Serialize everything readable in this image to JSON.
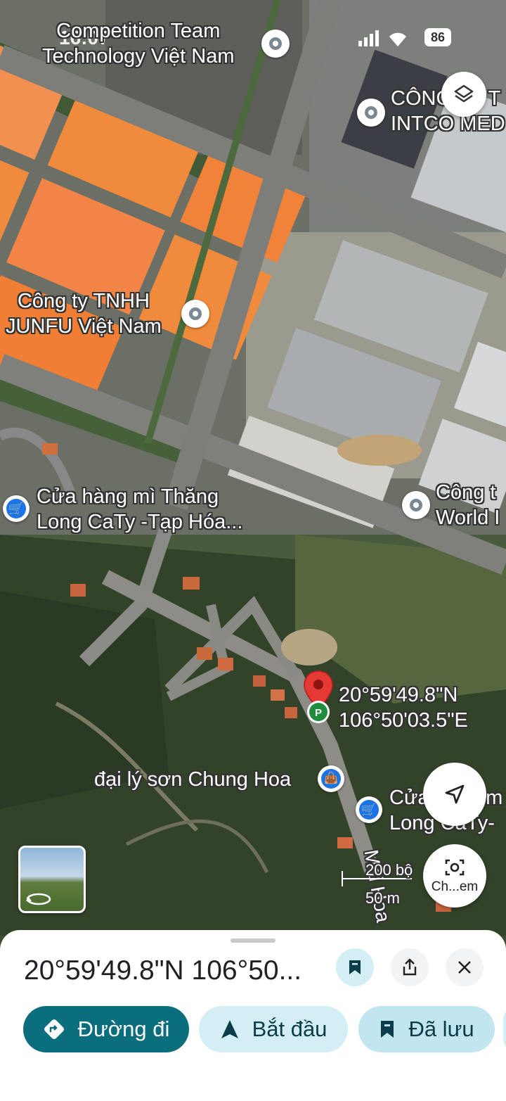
{
  "status_bar": {
    "time": "16:07",
    "battery": "86"
  },
  "map": {
    "pois": [
      {
        "name_line1": "Competition Team",
        "name_line2": "Technology Việt Nam"
      },
      {
        "name_line1": "CÔNG TY T",
        "name_line2": "INTCO MED"
      },
      {
        "name_line1": "Công ty TNHH",
        "name_line2": "JUNFU Việt Nam"
      },
      {
        "name_line1": "Cửa hàng mì Thăng",
        "name_line2": "Long CaTy -Tạp Hóa..."
      },
      {
        "name_line1": "Công t",
        "name_line2": "World I"
      },
      {
        "name_line1": "đại lý sơn Chung Hoa",
        "name_line2": ""
      },
      {
        "name_line1": "Cửa hàng m",
        "name_line2": "Long CaTy-"
      }
    ],
    "dropped_pin": {
      "lat": "20°59'49.8\"N",
      "lng": "106°50'03.5\"E"
    },
    "road_label": "Mai Hoa",
    "scale": {
      "feet": "200 bộ",
      "meters": "50 m"
    },
    "lens_label": "Ch...em",
    "icons": {
      "layers": "layers-icon",
      "locate": "navigation-arrow-icon",
      "lens": "lens-camera-icon",
      "streetview": "street-view-rotate-icon"
    }
  },
  "sheet": {
    "title": "20°59'49.8\"N 106°50...",
    "actions": {
      "directions": "Đường đi",
      "start": "Bắt đầu",
      "saved": "Đã lưu"
    },
    "colors": {
      "teal": "#0b6e7d",
      "light_blue": "#d3eef5",
      "saved_bg": "#c2e6ef"
    }
  }
}
